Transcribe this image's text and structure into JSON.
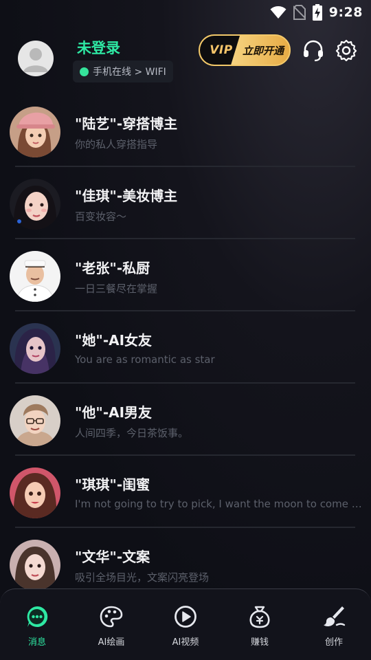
{
  "status_bar": {
    "time": "9:28",
    "icons": [
      "wifi-icon",
      "no-sim-icon",
      "battery-charging-icon"
    ]
  },
  "header": {
    "username": "未登录",
    "network_status": "手机在线 > WIFI",
    "vip": {
      "badge": "VIP",
      "label": "立即开通"
    },
    "icons": [
      "headset-icon",
      "settings-gear-icon"
    ]
  },
  "chats": [
    {
      "title": "\"陆艺\"-穿搭博主",
      "subtitle": "你的私人穿搭指导"
    },
    {
      "title": "\"佳琪\"-美妆博主",
      "subtitle": "百变妆容～"
    },
    {
      "title": "\"老张\"-私厨",
      "subtitle": "一日三餐尽在掌握"
    },
    {
      "title": "\"她\"-AI女友",
      "subtitle": "You are as romantic as star"
    },
    {
      "title": "\"他\"-AI男友",
      "subtitle": "人间四季，今日茶饭事。"
    },
    {
      "title": "\"琪琪\"-闺蜜",
      "subtitle": "I'm not going to try to pick, I want the moon to come t..."
    },
    {
      "title": "\"文华\"-文案",
      "subtitle": "吸引全场目光，文案闪亮登场"
    }
  ],
  "bottom_nav": [
    {
      "label": "消息",
      "icon": "message-bubble-icon",
      "active": true
    },
    {
      "label": "AI绘画",
      "icon": "palette-icon",
      "active": false
    },
    {
      "label": "AI视频",
      "icon": "play-circle-icon",
      "active": false
    },
    {
      "label": "赚钱",
      "icon": "money-bag-icon",
      "active": false
    },
    {
      "label": "创作",
      "icon": "brush-icon",
      "active": false
    }
  ],
  "colors": {
    "accent": "#2ee8a3",
    "vip_gold": "#f3c96a",
    "background": "#0f1017"
  }
}
